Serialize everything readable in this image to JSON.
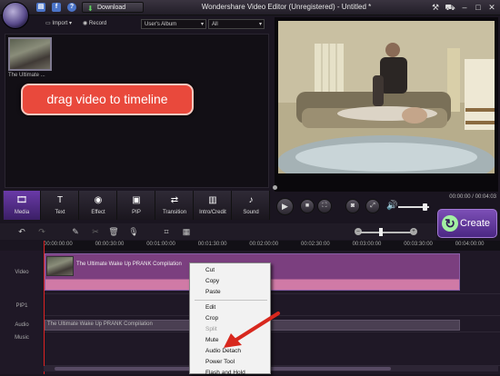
{
  "app": {
    "title": "Wondershare Video Editor (Unregistered) - Untitled *",
    "download_label": "Download",
    "quick_icons": [
      {
        "name": "calendar-icon",
        "glyph": "▤"
      },
      {
        "name": "facebook-icon",
        "glyph": "f"
      },
      {
        "name": "help-icon",
        "glyph": "?"
      }
    ]
  },
  "library": {
    "import_label": "Import",
    "record_label": "Record",
    "album_select": "User's Album",
    "filter_select": "All",
    "clip_label": "The Ultimate ...",
    "callout": "drag video to timeline"
  },
  "preview": {
    "time_readout": "00:00:00 / 00:04:03",
    "volume_level": 0.85
  },
  "tools": {
    "tabs": [
      {
        "label": "Media",
        "icon": "media-icon",
        "glyph": "🎞",
        "active": true
      },
      {
        "label": "Text",
        "icon": "text-icon",
        "glyph": "T",
        "active": false
      },
      {
        "label": "Effect",
        "icon": "effect-icon",
        "glyph": "◉",
        "active": false
      },
      {
        "label": "PIP",
        "icon": "pip-icon",
        "glyph": "▣",
        "active": false
      },
      {
        "label": "Transition",
        "icon": "transition-icon",
        "glyph": "⇄",
        "active": false
      },
      {
        "label": "Intro/Credit",
        "icon": "intro-credit-icon",
        "glyph": "▥",
        "active": false
      },
      {
        "label": "Sound",
        "icon": "sound-icon",
        "glyph": "♪",
        "active": false
      }
    ],
    "create_label": "Create"
  },
  "timeline": {
    "ticks": [
      "00:00:00:00",
      "00:00:30:00",
      "00:01:00:00",
      "00:01:30:00",
      "00:02:00:00",
      "00:02:30:00",
      "00:03:00:00",
      "00:03:30:00",
      "00:04:00:00"
    ],
    "tracks": [
      "Video",
      "PIP1",
      "Audio",
      "Music"
    ],
    "video_clip_label": "The Ultimate Wake Up PRANK Compilation",
    "audio_clip_label": "The Ultimate Wake Up PRANK Compilation",
    "zoom_level": 0.4
  },
  "context_menu": {
    "items": [
      {
        "label": "Cut",
        "enabled": true
      },
      {
        "label": "Copy",
        "enabled": true
      },
      {
        "label": "Paste",
        "enabled": true
      },
      {
        "label": "Edit",
        "enabled": true
      },
      {
        "label": "Crop",
        "enabled": true
      },
      {
        "label": "Split",
        "enabled": false
      },
      {
        "label": "Mute",
        "enabled": true
      },
      {
        "label": "Audio Detach",
        "enabled": true
      },
      {
        "label": "Power Tool",
        "enabled": true
      },
      {
        "label": "Flash and Hold",
        "enabled": true
      }
    ]
  },
  "colors": {
    "accent": "#6a3aa8",
    "callout": "#e9493c",
    "video_clip": "#7b3f7f",
    "playhead": "#dd2222"
  }
}
